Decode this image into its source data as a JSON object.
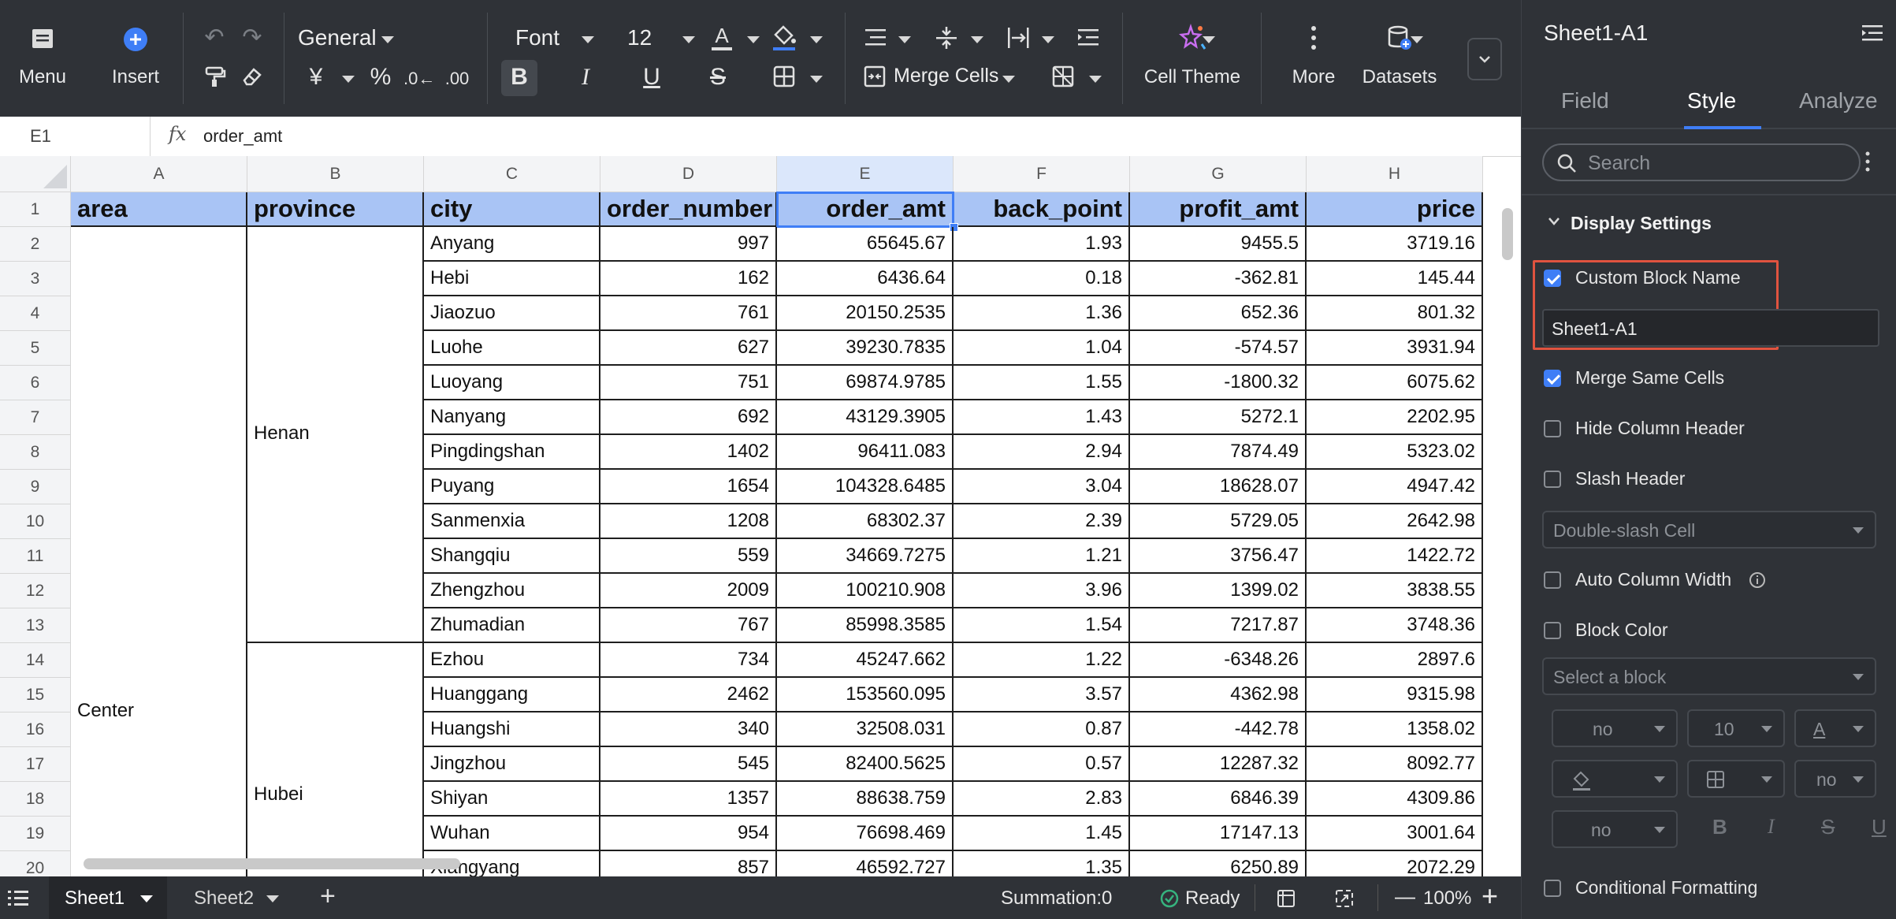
{
  "toolbar": {
    "menu_label": "Menu",
    "insert_label": "Insert",
    "format_value": "General",
    "font_value": "Font",
    "font_size_value": "12",
    "merge_label": "Merge Cells",
    "cell_theme_label": "Cell Theme",
    "more_label": "More",
    "datasets_label": "Datasets",
    "accent_color": "#3f7ef6"
  },
  "formula_bar": {
    "cell_ref": "E1",
    "fx_label": "fx",
    "value": "order_amt"
  },
  "grid": {
    "columns": [
      "A",
      "B",
      "C",
      "D",
      "E",
      "F",
      "G",
      "H"
    ],
    "header_fill": "#a9c4f5",
    "headers": [
      "area",
      "province",
      "city",
      "order_number",
      "order_amt",
      "back_point",
      "profit_amt",
      "price"
    ],
    "row_numbers": [
      "1",
      "2",
      "3",
      "4",
      "5",
      "6",
      "7",
      "8",
      "9",
      "10",
      "11",
      "12",
      "13",
      "14",
      "15",
      "16",
      "17",
      "18",
      "19",
      "20"
    ],
    "area_merged": "Center",
    "province_groups": [
      "Henan",
      "Hubei"
    ],
    "rows": [
      [
        "Anyang",
        "997",
        "65645.67",
        "1.93",
        "9455.5",
        "3719.16"
      ],
      [
        "Hebi",
        "162",
        "6436.64",
        "0.18",
        "-362.81",
        "145.44"
      ],
      [
        "Jiaozuo",
        "761",
        "20150.2535",
        "1.36",
        "652.36",
        "801.32"
      ],
      [
        "Luohe",
        "627",
        "39230.7835",
        "1.04",
        "-574.57",
        "3931.94"
      ],
      [
        "Luoyang",
        "751",
        "69874.9785",
        "1.55",
        "-1800.32",
        "6075.62"
      ],
      [
        "Nanyang",
        "692",
        "43129.3905",
        "1.43",
        "5272.1",
        "2202.95"
      ],
      [
        "Pingdingshan",
        "1402",
        "96411.083",
        "2.94",
        "7874.49",
        "5323.02"
      ],
      [
        "Puyang",
        "1654",
        "104328.6485",
        "3.04",
        "18628.07",
        "4947.42"
      ],
      [
        "Sanmenxia",
        "1208",
        "68302.37",
        "2.39",
        "5729.05",
        "2642.98"
      ],
      [
        "Shangqiu",
        "559",
        "34669.7275",
        "1.21",
        "3756.47",
        "1422.72"
      ],
      [
        "Zhengzhou",
        "2009",
        "100210.908",
        "3.96",
        "1399.02",
        "3838.55"
      ],
      [
        "Zhumadian",
        "767",
        "85998.3585",
        "1.54",
        "7217.87",
        "3748.36"
      ],
      [
        "Ezhou",
        "734",
        "45247.662",
        "1.22",
        "-6348.26",
        "2897.6"
      ],
      [
        "Huanggang",
        "2462",
        "153560.095",
        "3.57",
        "4362.98",
        "9315.98"
      ],
      [
        "Huangshi",
        "340",
        "32508.031",
        "0.87",
        "-442.78",
        "1358.02"
      ],
      [
        "Jingzhou",
        "545",
        "82400.5625",
        "0.57",
        "12287.32",
        "8092.77"
      ],
      [
        "Shiyan",
        "1357",
        "88638.759",
        "2.83",
        "6846.39",
        "4309.86"
      ],
      [
        "Wuhan",
        "954",
        "76698.469",
        "1.45",
        "17147.13",
        "3001.64"
      ],
      [
        "Xiangyang",
        "857",
        "46592.727",
        "1.35",
        "6250.89",
        "2072.29"
      ]
    ]
  },
  "sheet_tabs": {
    "tabs": [
      "Sheet1",
      "Sheet2"
    ],
    "add_label": "+",
    "summation": "Summation:0",
    "status": "Ready",
    "zoom": "100%",
    "zoom_minus": "—",
    "zoom_plus": "+"
  },
  "panel": {
    "title": "Sheet1-A1",
    "tabs": [
      "Field",
      "Style",
      "Analyze"
    ],
    "active_tab": "Style",
    "search_placeholder": "Search",
    "section_title": "Display Settings",
    "custom_block_name_label": "Custom Block Name",
    "custom_block_name_value": "Sheet1-A1",
    "merge_same_cells": "Merge Same Cells",
    "hide_column_header": "Hide Column Header",
    "slash_header": "Slash Header",
    "slash_select": "Double-slash Cell",
    "auto_column_width": "Auto Column Width",
    "block_color": "Block Color",
    "block_select": "Select a block",
    "style_no_1": "no",
    "style_size": "10",
    "style_no_2": "no",
    "style_no_3": "no",
    "style_font_color_glyph": "A",
    "conditional_formatting": "Conditional Formatting",
    "highlight_color": "#e0533f"
  }
}
